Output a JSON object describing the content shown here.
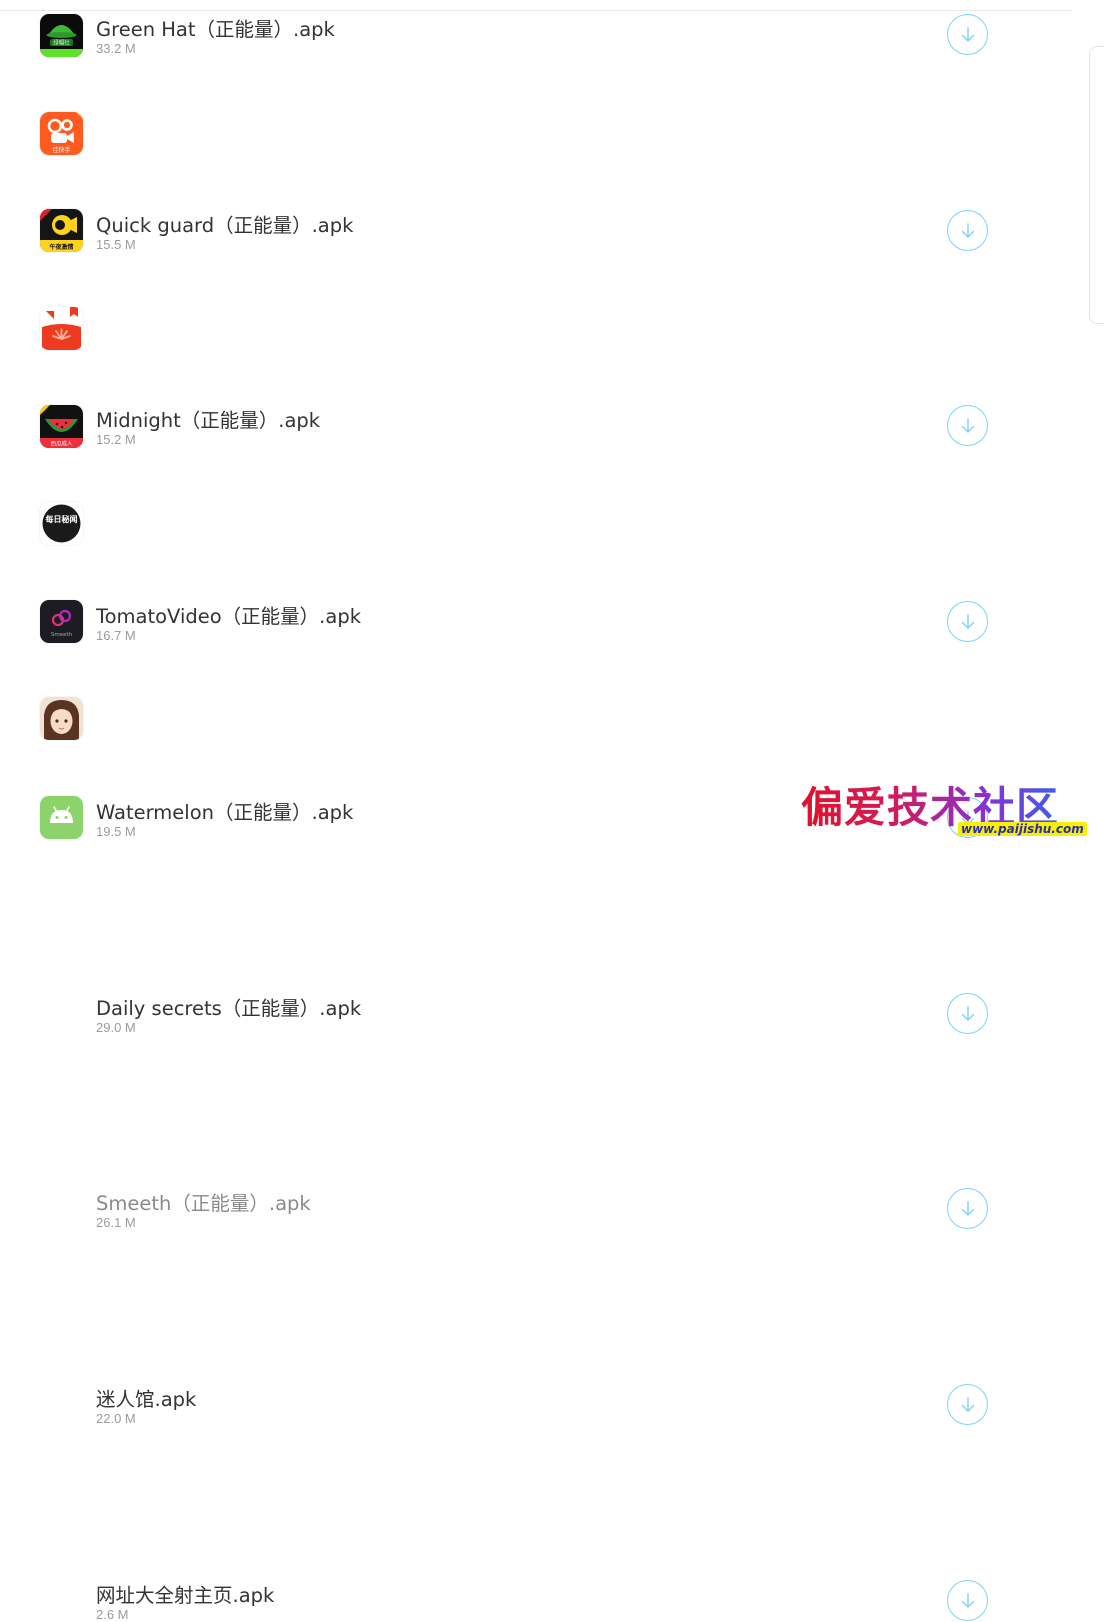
{
  "accent_color": "#7fd3f5",
  "apps": [
    {
      "name": "Green Hat（正能量）.apk",
      "size": "33.2 M",
      "icon": "green-hat-icon",
      "dim": false
    },
    {
      "name": "Quick guard（正能量）.apk",
      "size": "15.5 M",
      "icon": "quick-guard-icon",
      "dim": false
    },
    {
      "name": "Midnight（正能量）.apk",
      "size": "15.2 M",
      "icon": "midnight-icon",
      "dim": false
    },
    {
      "name": "TomatoVideo（正能量）.apk",
      "size": "16.7 M",
      "icon": "tomato-video-icon",
      "dim": false
    },
    {
      "name": "Watermelon（正能量）.apk",
      "size": "19.5 M",
      "icon": "watermelon-icon",
      "dim": false
    },
    {
      "name": "Daily secrets（正能量）.apk",
      "size": "29.0 M",
      "icon": "daily-secrets-icon",
      "dim": false
    },
    {
      "name": "Smeeth（正能量）.apk",
      "size": "26.1 M",
      "icon": "smeeth-icon",
      "dim": true
    },
    {
      "name": "迷人馆.apk",
      "size": "22.0 M",
      "icon": "mirenguan-icon",
      "dim": false
    },
    {
      "name": "网址大全射主页.apk",
      "size": "2.6 M",
      "icon": "android-icon",
      "dim": false
    }
  ],
  "icon_labels": {
    "green_hat": "绿帽社",
    "quick_guard": "佳快手",
    "midnight": "午夜激情",
    "daily_secrets": "每日秘闻",
    "smeeth": "Smeeth",
    "watermelon": "西瓜成人"
  },
  "watermark": {
    "title": "偏爱技术社区",
    "url": "www.paijishu.com"
  }
}
